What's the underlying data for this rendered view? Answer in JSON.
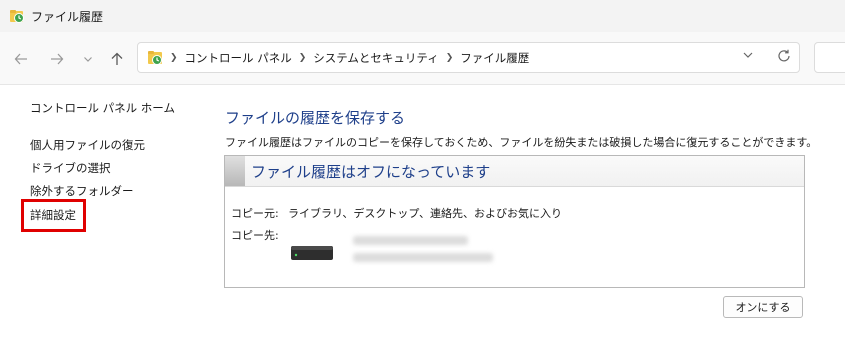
{
  "window": {
    "title": "ファイル履歴"
  },
  "address_bar": {
    "crumbs": [
      "コントロール パネル",
      "システムとセキュリティ",
      "ファイル履歴"
    ]
  },
  "sidebar": {
    "home": "コントロール パネル ホーム",
    "items": [
      "個人用ファイルの復元",
      "ドライブの選択",
      "除外するフォルダー",
      "詳細設定"
    ]
  },
  "main": {
    "title": "ファイルの履歴を保存する",
    "description": "ファイル履歴はファイルのコピーを保存しておくため、ファイルを紛失または破損した場合に復元することができます。",
    "status": "ファイル履歴はオフになっています",
    "copy_from_label": "コピー元:",
    "copy_from_value": "ライブラリ、デスクトップ、連絡先、およびお気に入り",
    "copy_to_label": "コピー先:",
    "turn_on_button": "オンにする"
  },
  "colors": {
    "title_blue": "#1e3f8a",
    "highlight_red": "#e00000"
  },
  "icons": [
    "file-history-icon",
    "back-arrow-icon",
    "forward-arrow-icon",
    "recent-dropdown-icon",
    "up-arrow-icon",
    "location-icon",
    "chevron-right-icon",
    "chevron-down-icon",
    "refresh-icon",
    "drive-icon"
  ]
}
